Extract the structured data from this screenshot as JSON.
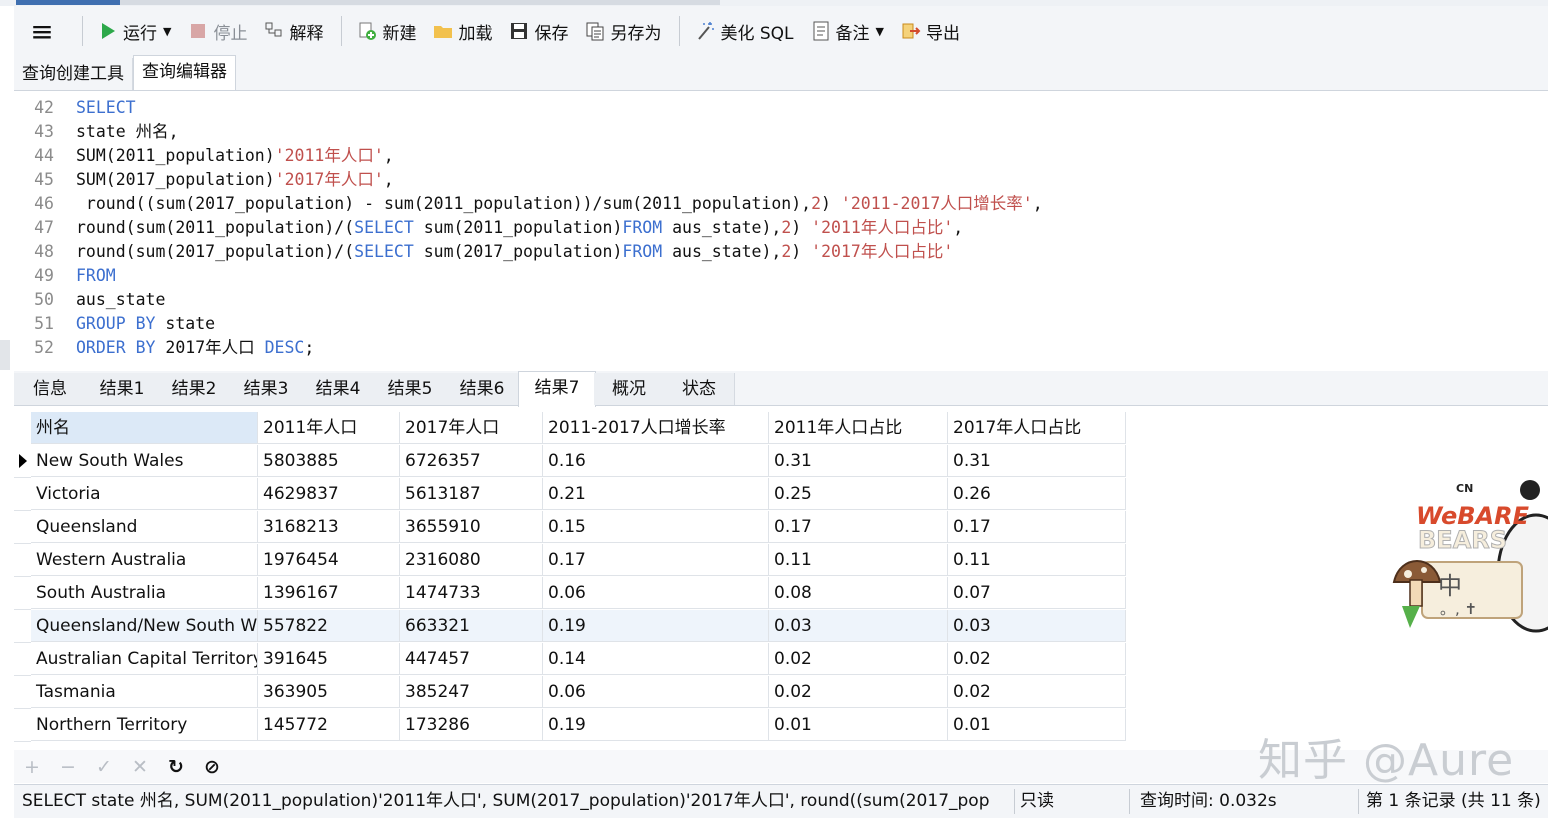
{
  "toolbar": {
    "menu_icon": "hamburger-icon",
    "run": "运行",
    "stop": "停止",
    "explain": "解释",
    "new": "新建",
    "load": "加载",
    "save": "保存",
    "save_as": "另存为",
    "beautify": "美化 SQL",
    "comment": "备注",
    "export": "导出"
  },
  "subtabs": [
    "查询创建工具",
    "查询编辑器"
  ],
  "editor": {
    "lines": [
      {
        "n": "42",
        "parts": [
          {
            "t": "SELECT",
            "c": "kw"
          }
        ]
      },
      {
        "n": "43",
        "parts": [
          {
            "t": "state 州名,",
            "c": ""
          }
        ]
      },
      {
        "n": "44",
        "parts": [
          {
            "t": "SUM(2011_population)",
            "c": ""
          },
          {
            "t": "'2011年人口'",
            "c": "st"
          },
          {
            "t": ",",
            "c": ""
          }
        ]
      },
      {
        "n": "45",
        "parts": [
          {
            "t": "SUM(2017_population)",
            "c": ""
          },
          {
            "t": "'2017年人口'",
            "c": "st"
          },
          {
            "t": ",",
            "c": ""
          }
        ]
      },
      {
        "n": "46",
        "parts": [
          {
            "t": " round((sum(2017_population) - sum(2011_population))/sum(2011_population),",
            "c": ""
          },
          {
            "t": "2",
            "c": "nm"
          },
          {
            "t": ") ",
            "c": ""
          },
          {
            "t": "'2011-2017人口增长率'",
            "c": "st"
          },
          {
            "t": ",",
            "c": ""
          }
        ]
      },
      {
        "n": "47",
        "parts": [
          {
            "t": "round(sum(2011_population)/(",
            "c": ""
          },
          {
            "t": "SELECT",
            "c": "kw"
          },
          {
            "t": " sum(2011_population)",
            "c": ""
          },
          {
            "t": "FROM",
            "c": "kw"
          },
          {
            "t": " aus_state),",
            "c": ""
          },
          {
            "t": "2",
            "c": "nm"
          },
          {
            "t": ") ",
            "c": ""
          },
          {
            "t": "'2011年人口占比'",
            "c": "st"
          },
          {
            "t": ",",
            "c": ""
          }
        ]
      },
      {
        "n": "48",
        "parts": [
          {
            "t": "round(sum(2017_population)/(",
            "c": ""
          },
          {
            "t": "SELECT",
            "c": "kw"
          },
          {
            "t": " sum(2017_population)",
            "c": ""
          },
          {
            "t": "FROM",
            "c": "kw"
          },
          {
            "t": " aus_state),",
            "c": ""
          },
          {
            "t": "2",
            "c": "nm"
          },
          {
            "t": ") ",
            "c": ""
          },
          {
            "t": "'2017年人口占比'",
            "c": "st"
          }
        ]
      },
      {
        "n": "49",
        "parts": [
          {
            "t": "FROM",
            "c": "kw"
          }
        ]
      },
      {
        "n": "50",
        "parts": [
          {
            "t": "aus_state",
            "c": ""
          }
        ]
      },
      {
        "n": "51",
        "parts": [
          {
            "t": "GROUP BY",
            "c": "kw"
          },
          {
            "t": " state",
            "c": ""
          }
        ]
      },
      {
        "n": "52",
        "parts": [
          {
            "t": "ORDER BY",
            "c": "kw"
          },
          {
            "t": " 2017年人口 ",
            "c": ""
          },
          {
            "t": "DESC",
            "c": "kw"
          },
          {
            "t": ";",
            "c": ""
          }
        ]
      }
    ]
  },
  "result_tabs": [
    "信息",
    "结果1",
    "结果2",
    "结果3",
    "结果4",
    "结果5",
    "结果6",
    "结果7",
    "概况",
    "状态"
  ],
  "active_result_tab": "结果7",
  "table": {
    "columns": [
      "州名",
      "2011年人口",
      "2017年人口",
      "2011-2017人口增长率",
      "2011年人口占比",
      "2017年人口占比"
    ],
    "rows": [
      [
        "New South Wales",
        "5803885",
        "6726357",
        "0.16",
        "0.31",
        "0.31"
      ],
      [
        "Victoria",
        "4629837",
        "5613187",
        "0.21",
        "0.25",
        "0.26"
      ],
      [
        "Queensland",
        "3168213",
        "3655910",
        "0.15",
        "0.17",
        "0.17"
      ],
      [
        "Western Australia",
        "1976454",
        "2316080",
        "0.17",
        "0.11",
        "0.11"
      ],
      [
        "South Australia",
        "1396167",
        "1474733",
        "0.06",
        "0.08",
        "0.07"
      ],
      [
        "Queensland/New South Wales",
        "557822",
        "663321",
        "0.19",
        "0.03",
        "0.03"
      ],
      [
        "Australian Capital Territory",
        "391645",
        "447457",
        "0.14",
        "0.02",
        "0.02"
      ],
      [
        "Tasmania",
        "363905",
        "385247",
        "0.06",
        "0.02",
        "0.02"
      ],
      [
        "Northern Territory",
        "145772",
        "173286",
        "0.19",
        "0.01",
        "0.01"
      ]
    ]
  },
  "bottom_buttons": [
    "add-row-icon",
    "delete-row-icon",
    "apply-icon",
    "discard-icon",
    "refresh-icon",
    "stop-icon"
  ],
  "status": {
    "sql": "SELECT state 州名, SUM(2011_population)'2011年人口', SUM(2017_population)'2017年人口',  round((sum(2017_pop",
    "readonly": "只读",
    "query_time": "查询时间: 0.032s",
    "records": "第 1 条记录 (共 11 条)"
  },
  "watermark": "知乎 @Aure",
  "sticker": {
    "brand": "CN",
    "line1": "WeBARE",
    "line2": "BEARS",
    "sign": "中",
    "marks": "。, ✝"
  }
}
